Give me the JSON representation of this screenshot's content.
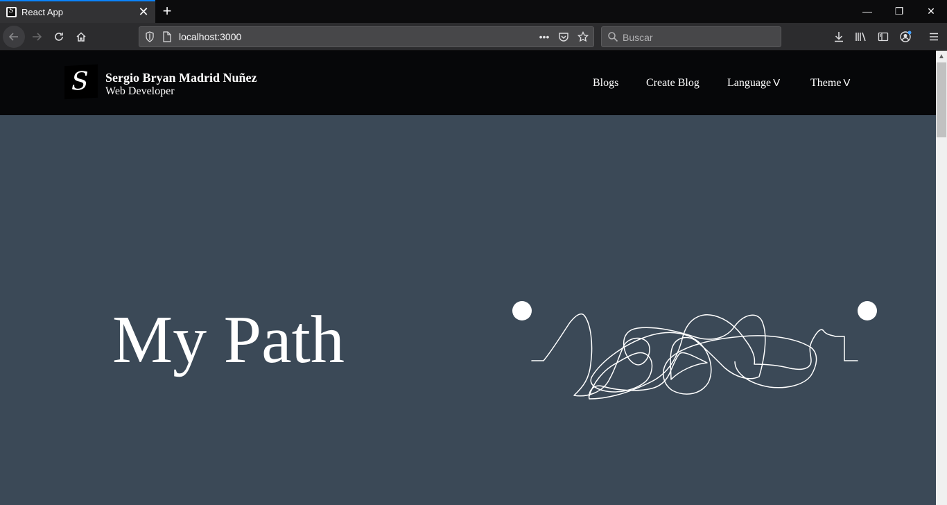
{
  "browser": {
    "tab_title": "React App",
    "url": "localhost:3000",
    "search_placeholder": "Buscar"
  },
  "header": {
    "logo_letter": "S",
    "name": "Sergio Bryan Madrid Nuñez",
    "role": "Web Developer",
    "menu": [
      {
        "label": "Blogs"
      },
      {
        "label": "Create Blog"
      },
      {
        "label": "Language",
        "chevron": "V"
      },
      {
        "label": "Theme",
        "chevron": "V"
      }
    ]
  },
  "hero": {
    "title": "My Path"
  },
  "colors": {
    "page_bg": "#3b4957",
    "header_bg": "#060709",
    "accent": "#0a84ff"
  }
}
